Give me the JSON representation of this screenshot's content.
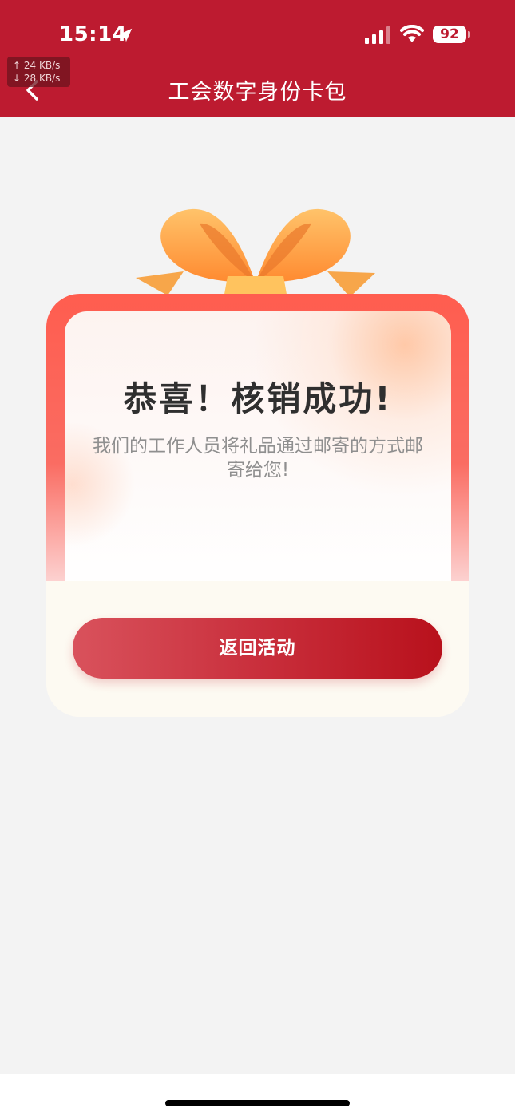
{
  "status_bar": {
    "time": "15:14",
    "battery": "92",
    "upload_speed": "↑ 24 KB/s",
    "download_speed": "↓ 28 KB/s"
  },
  "header": {
    "title": "工会数字身份卡包",
    "background": "#bd1b30"
  },
  "gift_card": {
    "headline": "恭喜！核销成功!",
    "message": "我们的工作人员将礼品通过邮寄的方式邮寄给您!",
    "button_label": "返回活动",
    "accent": "#c92f3c"
  },
  "icons": [
    "location-arrow-icon",
    "signal-icon",
    "wifi-icon",
    "battery-icon",
    "back-chevron-icon",
    "gift-bow-icon"
  ]
}
